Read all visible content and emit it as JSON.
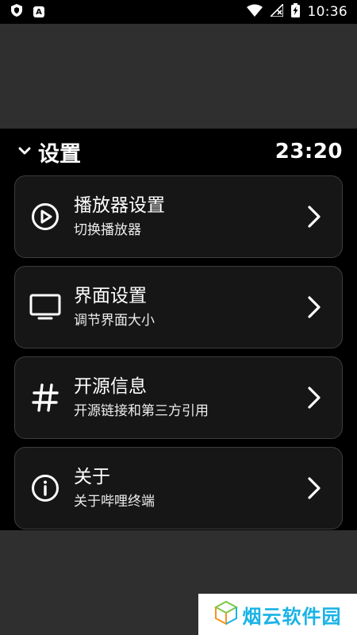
{
  "status_bar": {
    "time": "10:36",
    "left_icons": [
      "shield-icon",
      "a-badge-icon"
    ],
    "right_icons": [
      "wifi-icon",
      "signal-off-icon",
      "battery-charging-icon"
    ]
  },
  "header": {
    "title": "设置",
    "clock": "23:20"
  },
  "menu": [
    {
      "title": "播放器设置",
      "subtitle": "切换播放器",
      "icon": "play-circle-icon"
    },
    {
      "title": "界面设置",
      "subtitle": "调节界面大小",
      "icon": "monitor-icon"
    },
    {
      "title": "开源信息",
      "subtitle": "开源链接和第三方引用",
      "icon": "hash-icon"
    },
    {
      "title": "关于",
      "subtitle": "关于哔哩终端",
      "icon": "info-circle-icon"
    }
  ],
  "watermark": {
    "text": "烟云软件园"
  },
  "colors": {
    "panel_bg": "#000000",
    "outer_bg": "#2f2f2f",
    "card_bg": "#161616",
    "card_border": "#3d3d3d",
    "watermark_accent": "#19b3e6"
  }
}
